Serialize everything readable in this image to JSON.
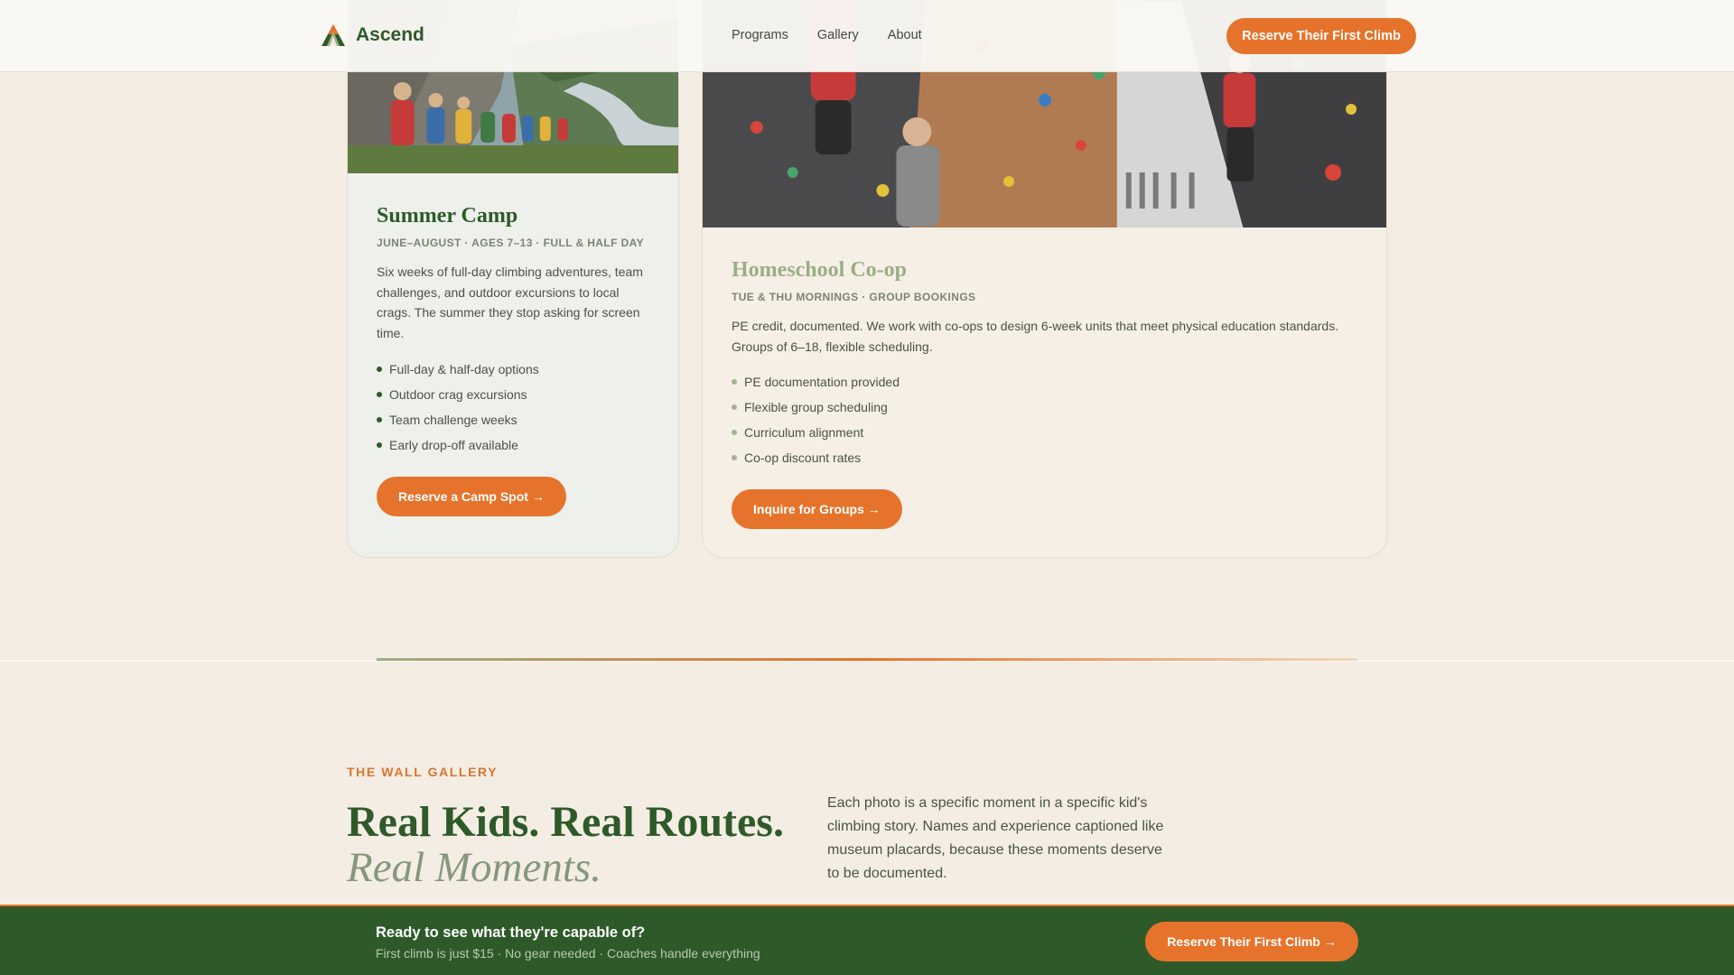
{
  "header": {
    "brand": "Ascend",
    "nav": [
      "Programs",
      "Gallery",
      "About"
    ],
    "cta": "Reserve Their First Climb"
  },
  "programs": [
    {
      "title": "Summer Camp",
      "meta": "JUNE–AUGUST · AGES 7–13 · FULL & HALF DAY",
      "description": "Six weeks of full-day climbing adventures, team challenges, and outdoor excursions to local crags. The summer they stop asking for screen time.",
      "bullets": [
        "Full-day & half-day options",
        "Outdoor crag excursions",
        "Team challenge weeks",
        "Early drop-off available"
      ],
      "cta": "Reserve a Camp Spot →"
    },
    {
      "title": "Homeschool Co-op",
      "meta": "TUE & THU MORNINGS · GROUP BOOKINGS",
      "description": "PE credit, documented. We work with co-ops to design 6-week units that meet physical education standards. Groups of 6–18, flexible scheduling.",
      "bullets": [
        "PE documentation provided",
        "Flexible group scheduling",
        "Curriculum alignment",
        "Co-op discount rates"
      ],
      "cta": "Inquire for Groups →"
    }
  ],
  "gallery": {
    "eyebrow": "THE WALL GALLERY",
    "title": "Real Kids. Real Routes.",
    "subtitle": "Real Moments.",
    "description": "Each photo is a specific moment in a specific kid's climbing story. Names and experience captioned like museum placards, because these moments deserve to be documented."
  },
  "cta_bar": {
    "title": "Ready to see what they're capable of?",
    "subtitle": "First climb is just $15 · No gear needed · Coaches handle everything",
    "button": "Reserve Their First Climb →"
  },
  "colors": {
    "brand_green": "#2e5a2a",
    "accent_orange": "#e6732b",
    "page_bg": "#f4ede3"
  }
}
